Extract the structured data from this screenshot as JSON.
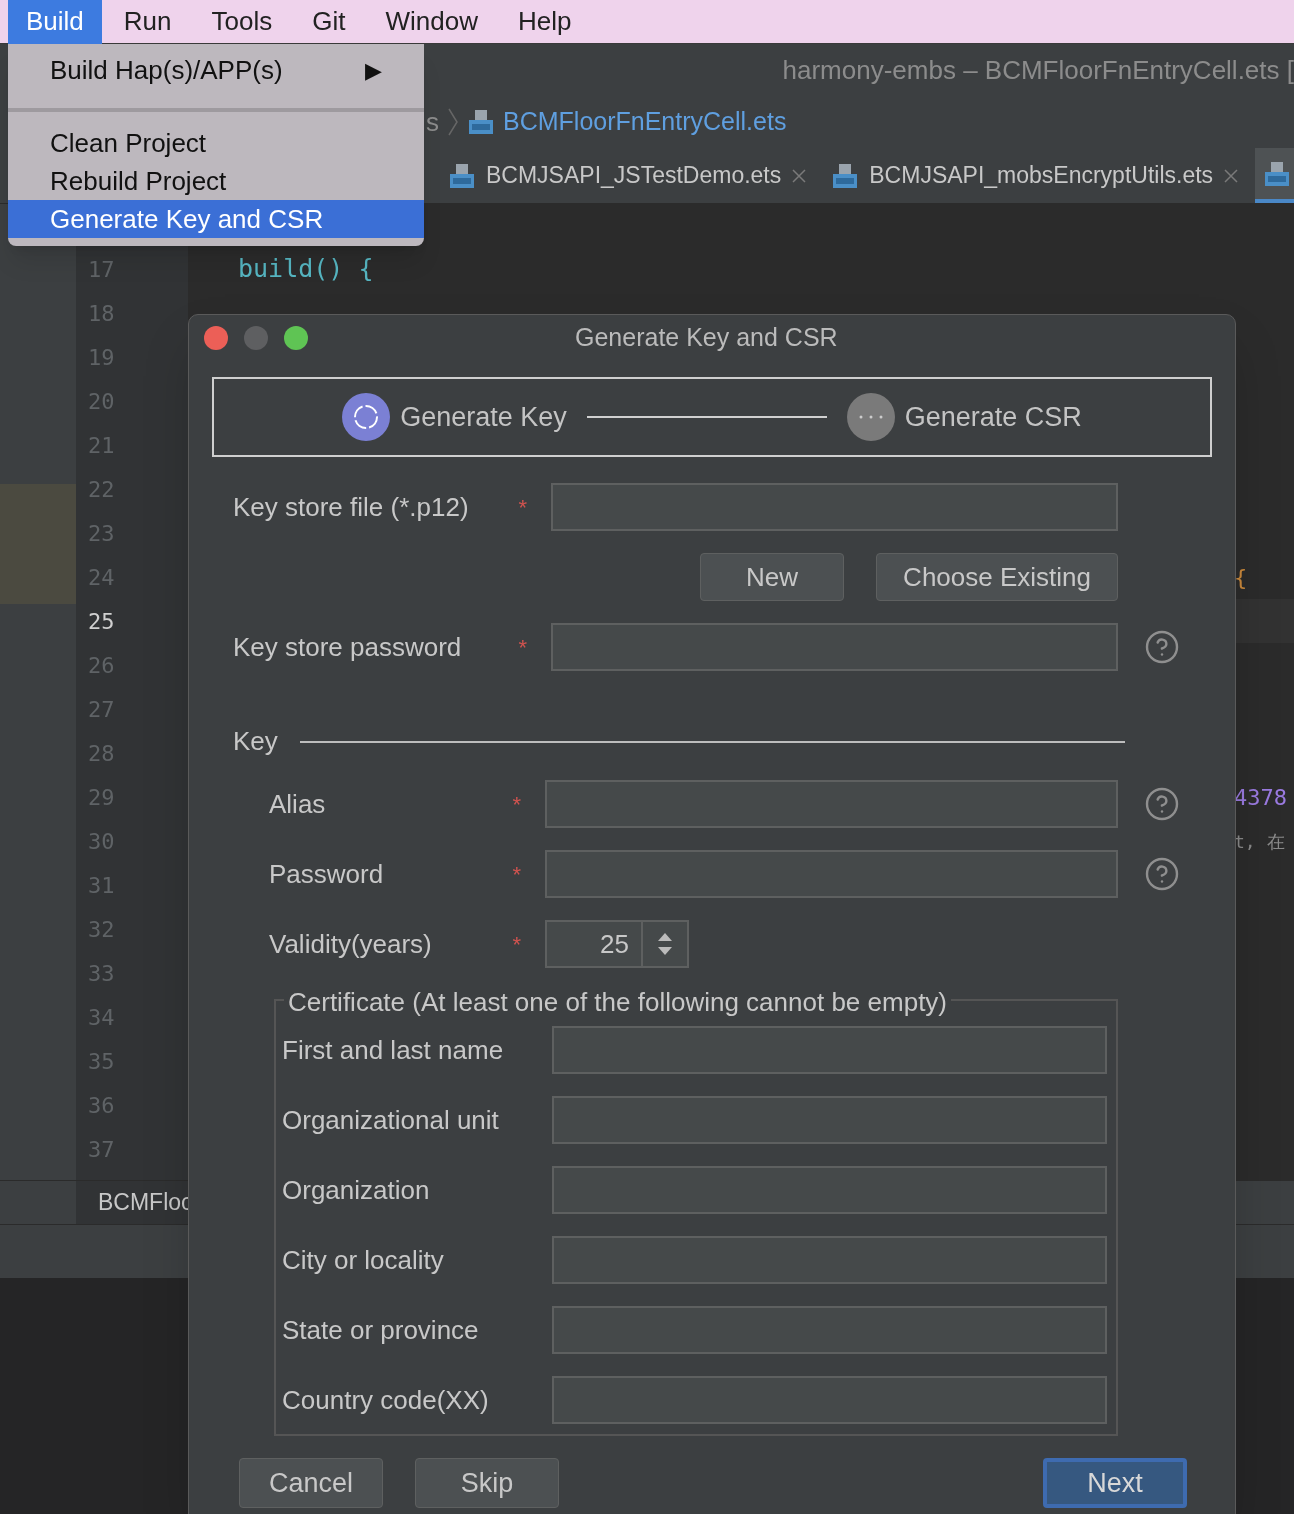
{
  "menu_bar": [
    {
      "label": "Build",
      "selected": true
    },
    {
      "label": "Run",
      "selected": false
    },
    {
      "label": "Tools",
      "selected": false
    },
    {
      "label": "Git",
      "selected": false
    },
    {
      "label": "Window",
      "selected": false
    },
    {
      "label": "Help",
      "selected": false
    }
  ],
  "build_menu": {
    "items": [
      {
        "label": "Build Hap(s)/APP(s)",
        "arrow": "▶",
        "kind": "submenu",
        "selected": false
      },
      {
        "kind": "separator"
      },
      {
        "label": "Clean Project",
        "kind": "item",
        "selected": false
      },
      {
        "label": "Rebuild Project",
        "kind": "item",
        "selected": false
      },
      {
        "label": "Generate Key and CSR",
        "kind": "item",
        "selected": true
      }
    ]
  },
  "window": {
    "title": "harmony-embs – BCMFloorFnEntryCell.ets ["
  },
  "breadcrumb": {
    "parent": "s",
    "file": "BCMFloorFnEntryCell.ets"
  },
  "tabs": [
    {
      "label": "BCMJSAPI_JSTestDemo.ets",
      "selected": false
    },
    {
      "label": "BCMJSAPI_mobsEncryptUtils.ets",
      "selected": false
    },
    {
      "selected": true
    }
  ],
  "editor": {
    "lines": [
      {
        "number": "17",
        "current": false,
        "code": "build() {"
      },
      {
        "number": "18",
        "current": false
      },
      {
        "number": "19",
        "current": false
      },
      {
        "number": "20",
        "current": false
      },
      {
        "number": "21",
        "current": false
      },
      {
        "number": "22",
        "current": false
      },
      {
        "number": "23",
        "current": false
      },
      {
        "number": "24",
        "current": false,
        "tail": "{",
        "kind": "brace"
      },
      {
        "number": "25",
        "current": true
      },
      {
        "number": "26",
        "current": false
      },
      {
        "number": "27",
        "current": false
      },
      {
        "number": "28",
        "current": false
      },
      {
        "number": "29",
        "current": false,
        "tail": "4378",
        "kind": "number"
      },
      {
        "number": "30",
        "current": false,
        "tail": "t, 在",
        "kind": "comment"
      },
      {
        "number": "31",
        "current": false
      },
      {
        "number": "32",
        "current": false
      },
      {
        "number": "33",
        "current": false
      },
      {
        "number": "34",
        "current": false
      },
      {
        "number": "35",
        "current": false
      },
      {
        "number": "36",
        "current": false
      },
      {
        "number": "37",
        "current": false
      }
    ]
  },
  "bottom_tab": {
    "label": "BCMFloc"
  },
  "dialog": {
    "title": "Generate Key and CSR",
    "steps": [
      {
        "label": "Generate Key",
        "active": true
      },
      {
        "label": "Generate CSR",
        "active": false
      }
    ],
    "keystore_fields": [
      {
        "label": "Key store file (*.p12)",
        "required_mark": "*",
        "help": false
      },
      {
        "label": "Key store password",
        "required_mark": "*",
        "help": true
      }
    ],
    "keystore_buttons": [
      "New",
      "Choose Existing"
    ],
    "key_section": {
      "title": "Key",
      "fields": [
        {
          "label": "Alias",
          "required_mark": "*",
          "help": true,
          "kind": "text"
        },
        {
          "label": "Password",
          "required_mark": "*",
          "help": true,
          "kind": "text"
        },
        {
          "label": "Validity(years)",
          "required_mark": "*",
          "help": false,
          "kind": "spinner",
          "value": "25"
        }
      ]
    },
    "certificate": {
      "legend": "Certificate (At least one of the following cannot be empty)",
      "fields": [
        "First and last name",
        "Organizational unit",
        "Organization",
        "City or locality",
        "State or province",
        "Country code(XX)"
      ]
    },
    "buttons": [
      {
        "label": "Cancel",
        "kind": "secondary"
      },
      {
        "label": "Skip",
        "kind": "secondary"
      },
      {
        "label": "Next",
        "kind": "primary"
      }
    ]
  }
}
